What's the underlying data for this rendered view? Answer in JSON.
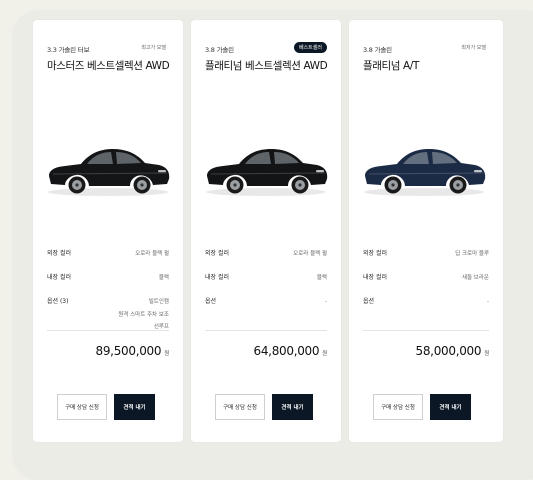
{
  "labels": {
    "exterior": "외장 컬러",
    "interior": "내장 컬러",
    "options": "옵션",
    "unit": "원",
    "buy_button": "구매 상담 신청",
    "quote_button": "견적 내기"
  },
  "cards": [
    {
      "engine": "3.3 가솔린 터보",
      "badge": "최고가 모델",
      "model": "마스터즈 베스트셀렉션 AWD",
      "car_color": "#131517",
      "exterior_color": "오로라 블랙 펄",
      "interior_color": "블랙",
      "options_label": "옵션 (3)",
      "options": [
        "빌트인캠",
        "원격 스마트 주차 보조",
        "선루프"
      ],
      "price": "89,500,000"
    },
    {
      "engine": "3.8 가솔린",
      "badge": "베스트셀러",
      "model": "플래티넘 베스트셀렉션 AWD",
      "car_color": "#121416",
      "exterior_color": "오로라 블랙 펄",
      "interior_color": "블랙",
      "options_label": "옵션",
      "options": [
        "-"
      ],
      "price": "64,800,000"
    },
    {
      "engine": "3.8 가솔린",
      "badge": "최저가 모델",
      "model": "플래티넘 A/T",
      "car_color": "#1b2a45",
      "exterior_color": "딥 크로마 블루",
      "interior_color": "새들 브라운",
      "options_label": "옵션",
      "options": [
        "-"
      ],
      "price": "58,000,000"
    }
  ]
}
